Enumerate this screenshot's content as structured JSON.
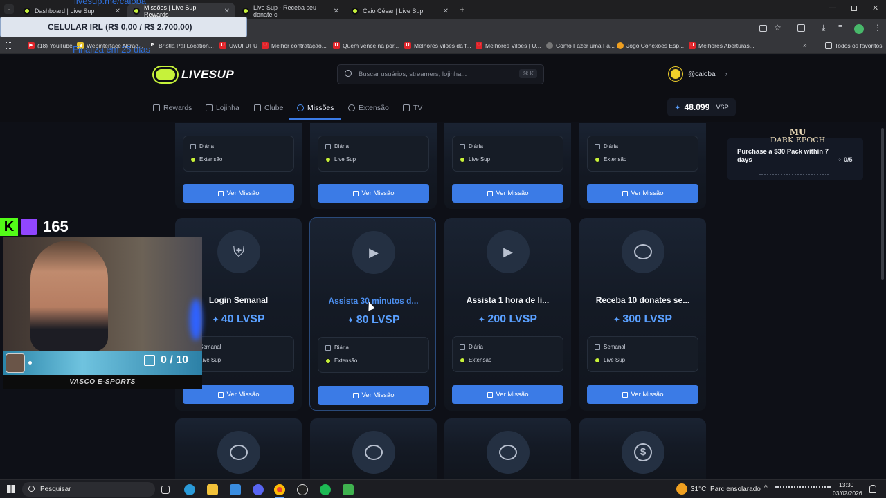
{
  "browser": {
    "tabs": [
      {
        "label": "Dashboard | Live Sup"
      },
      {
        "label": "Missões | Live Sup Rewards"
      },
      {
        "label": "Live Sup - Receba seu donate c"
      },
      {
        "label": "Caio César | Live Sup"
      }
    ],
    "bookmarks": [
      {
        "label": "(18) YouTube"
      },
      {
        "label": "Webinterface Nitrad..."
      },
      {
        "label": "Bristla Pal Location..."
      },
      {
        "label": "UwUFUFU"
      },
      {
        "label": "Melhor contratação..."
      },
      {
        "label": "Quem vence na por..."
      },
      {
        "label": "Melhores vilões da f..."
      },
      {
        "label": "Melhores Vilões | U..."
      },
      {
        "label": "Como Fazer uma Fa..."
      },
      {
        "label": "Jogo Conexões Esp..."
      },
      {
        "label": "Melhores Aberturas..."
      }
    ],
    "all_favorites": "Todos os favoritos"
  },
  "overlay": {
    "url": "livesup.me/caioba",
    "goal": "CELULAR IRL (R$ 0,00 / R$ 2.700,00)",
    "days_left": "Finaliza em 25 dias",
    "sub_count": "165",
    "chat_count": "0 / 10",
    "banner": "VASCO E-SPORTS"
  },
  "site": {
    "logo": "LIVESUP",
    "search_placeholder": "Buscar usuários, streamers, lojinha...",
    "search_shortcut": "⌘ K",
    "username": "@caioba",
    "balance": "48.099",
    "balance_unit": "LVSP",
    "nav": [
      {
        "label": "Rewards"
      },
      {
        "label": "Lojinha"
      },
      {
        "label": "Clube"
      },
      {
        "label": "Missões"
      },
      {
        "label": "Extensão"
      },
      {
        "label": "TV"
      }
    ]
  },
  "promo": {
    "brand_top": "MU",
    "brand_bottom": "DARK EPOCH",
    "title": "Purchase a $30 Pack within 7 days",
    "progress": "0/5"
  },
  "missions": {
    "button_label": "Ver Missão",
    "row1": [
      {
        "frequency": "Diária",
        "source": "Extensão"
      },
      {
        "frequency": "Diária",
        "source": "Live Sup"
      },
      {
        "frequency": "Diária",
        "source": "Live Sup"
      },
      {
        "frequency": "Diária",
        "source": "Extensão"
      }
    ],
    "row2": [
      {
        "title": "Login Semanal",
        "points": "40 LVSP",
        "frequency": "Semanal",
        "source": "Live Sup",
        "icon": "shield-question-icon"
      },
      {
        "title": "Assista 30 minutos d...",
        "points": "80 LVSP",
        "frequency": "Diária",
        "source": "Extensão",
        "icon": "play-screen-icon"
      },
      {
        "title": "Assista 1 hora de li...",
        "points": "200 LVSP",
        "frequency": "Diária",
        "source": "Extensão",
        "icon": "play-screen-icon"
      },
      {
        "title": "Receba 10 donates se...",
        "points": "300 LVSP",
        "frequency": "Semanal",
        "source": "Live Sup",
        "icon": "chat-bubble-icon"
      }
    ],
    "row3": [
      {
        "icon": "chat-bubble-icon"
      },
      {
        "icon": "chat-bubble-icon"
      },
      {
        "icon": "chat-bubble-icon"
      },
      {
        "icon": "dollar-coin-icon"
      }
    ]
  },
  "taskbar": {
    "search": "Pesquisar",
    "weather_temp": "31°C",
    "weather_desc": "Parc ensolarado",
    "time": "13:30",
    "date": "03/02/2026"
  }
}
